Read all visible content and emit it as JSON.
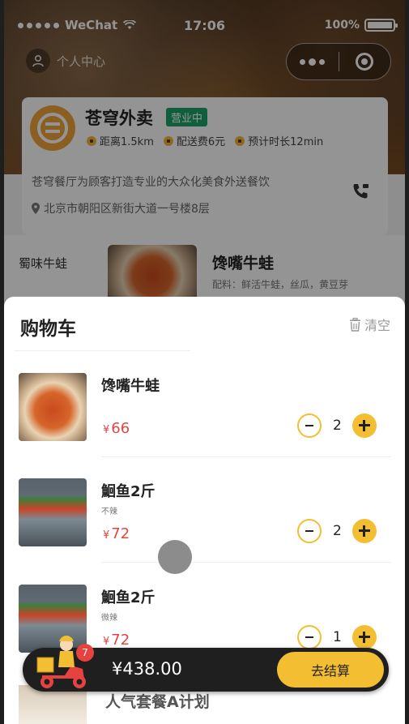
{
  "status_bar": {
    "carrier": "WeChat",
    "time": "17:06",
    "battery": "100%"
  },
  "header": {
    "profile_label": "个人中心"
  },
  "shop": {
    "name": "苍穹外卖",
    "status": "营业中",
    "distance": "距离1.5km",
    "delivery_fee": "配送费6元",
    "eta": "预计时长12min",
    "description": "苍穹餐厅为顾客打造专业的大众化美食外送餐饮",
    "address": "北京市朝阳区新街大道一号楼8层"
  },
  "menu": {
    "category": "蜀味牛蛙",
    "dish_name": "馋嘴牛蛙",
    "dish_desc": "配料：鲜活牛蛙，丝瓜，黄豆芽"
  },
  "cart": {
    "title": "购物车",
    "clear_label": "清空",
    "currency": "¥",
    "items": [
      {
        "name": "馋嘴牛蛙",
        "spec": "",
        "price": "66",
        "qty": "2",
        "image": "frog"
      },
      {
        "name": "鮰鱼2斤",
        "spec": "不辣",
        "price": "72",
        "qty": "2",
        "image": "fish"
      },
      {
        "name": "鮰鱼2斤",
        "spec": "微辣",
        "price": "72",
        "qty": "1",
        "image": "fish"
      }
    ],
    "peek_item_name": "人气套餐A计划"
  },
  "checkout": {
    "badge_count": "7",
    "total": "¥438.00",
    "button_label": "去结算"
  },
  "colors": {
    "accent": "#f4be33",
    "price": "#e64340",
    "status": "#1aa36a"
  }
}
